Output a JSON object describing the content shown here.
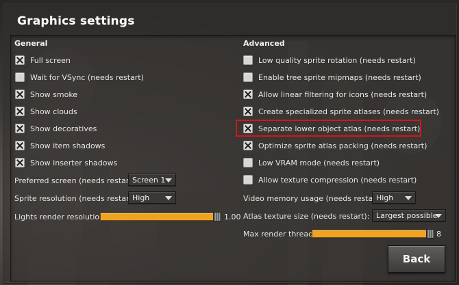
{
  "window": {
    "title": "Graphics settings"
  },
  "general": {
    "heading": "General",
    "checkboxes": [
      {
        "label": "Full screen",
        "checked": true
      },
      {
        "label": "Wait for VSync (needs restart)",
        "checked": false
      },
      {
        "label": "Show smoke",
        "checked": true
      },
      {
        "label": "Show clouds",
        "checked": true
      },
      {
        "label": "Show decoratives",
        "checked": true
      },
      {
        "label": "Show item shadows",
        "checked": true
      },
      {
        "label": "Show inserter shadows",
        "checked": true
      }
    ],
    "preferred_screen": {
      "label": "Preferred screen (needs restart)",
      "value": "Screen 1"
    },
    "sprite_resolution": {
      "label": "Sprite resolution (needs restart)",
      "value": "High"
    },
    "lights_render_resolution": {
      "label": "Lights render resolution",
      "value": "1.00",
      "fraction": 1.0
    }
  },
  "advanced": {
    "heading": "Advanced",
    "checkboxes": [
      {
        "label": "Low quality sprite rotation (needs restart)",
        "checked": false
      },
      {
        "label": "Enable tree sprite mipmaps (needs restart)",
        "checked": false
      },
      {
        "label": "Allow linear filtering for icons (needs restart)",
        "checked": true
      },
      {
        "label": "Create specialized sprite atlases (needs restart)",
        "checked": true
      },
      {
        "label": "Separate lower object atlas (needs restart)",
        "checked": true,
        "highlighted": true
      },
      {
        "label": "Optimize sprite atlas packing (needs restart)",
        "checked": true
      },
      {
        "label": "Low VRAM mode (needs restart)",
        "checked": false
      },
      {
        "label": "Allow texture compression (needs restart)",
        "checked": false
      }
    ],
    "video_memory_usage": {
      "label": "Video memory usage (needs restart):",
      "value": "High"
    },
    "atlas_texture_size": {
      "label": "Atlas texture size (needs restart):",
      "value": "Largest possible"
    },
    "max_render_threads": {
      "label": "Max render threads",
      "value": "8",
      "fraction": 1.0
    }
  },
  "footer": {
    "back_label": "Back"
  },
  "colors": {
    "accent": "#f0a321",
    "highlight": "#d01818"
  }
}
